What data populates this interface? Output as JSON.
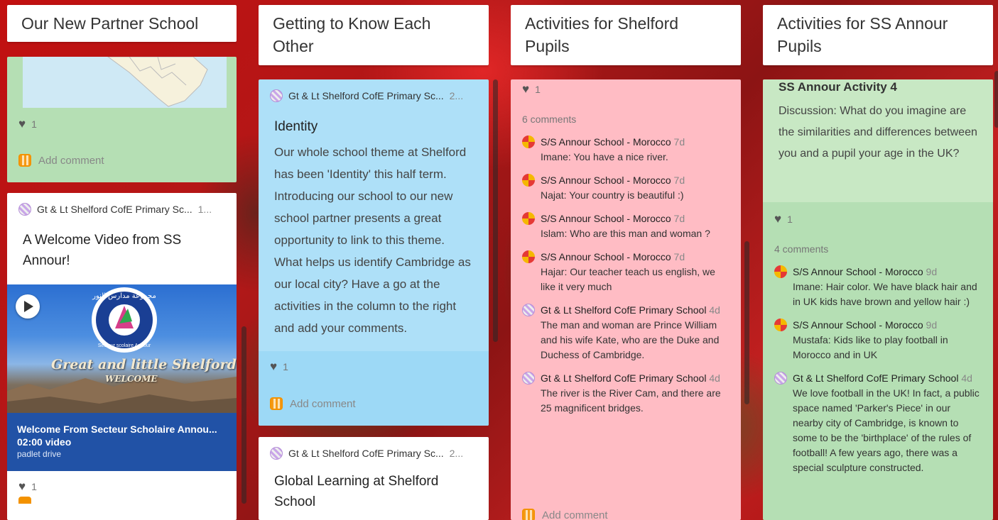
{
  "columns": [
    {
      "title": "Our New Partner School",
      "cards": [
        {
          "likes": "1",
          "add_comment": "Add comment"
        },
        {
          "author": "Gt & Lt Shelford CofE Primary Sc...",
          "time": "1...",
          "title": "A Welcome Video from SS Annour!",
          "video": {
            "arabic_caption": "مجموعة مدارس النور",
            "ring_caption": "Secteur scolaire Annour",
            "overlay_text": "Great and little Shelford",
            "overlay_text_2": "WELCOME",
            "name": "Welcome From Secteur Scholaire Annou...",
            "duration": "02:00 video",
            "source": "padlet drive"
          },
          "likes": "1"
        }
      ]
    },
    {
      "title": "Getting to Know Each Other",
      "cards": [
        {
          "author": "Gt & Lt Shelford CofE Primary Sc...",
          "time": "2...",
          "title": "Identity",
          "body": "Our whole school theme at Shelford has been 'Identity' this half term. Introducing our school to our new school partner presents a great opportunity to link to this theme. What helps us identify Cambridge as our local city? Have a go at the activities in the column to the right and add your comments.",
          "likes": "1",
          "add_comment": "Add comment"
        },
        {
          "author": "Gt & Lt Shelford CofE Primary Sc...",
          "time": "2...",
          "title": "Global Learning at Shelford School"
        }
      ]
    },
    {
      "title": "Activities for Shelford Pupils",
      "cards": [
        {
          "likes": "1",
          "comment_count": "6 comments",
          "comments": [
            {
              "author": "S/S Annour School - Morocco",
              "time": "7d",
              "text": "Imane: You have a nice river."
            },
            {
              "author": "S/S Annour School - Morocco",
              "time": "7d",
              "text": "Najat: Your country is beautiful :)"
            },
            {
              "author": "S/S Annour School - Morocco",
              "time": "7d",
              "text": "Islam: Who are this man and woman ?"
            },
            {
              "author": "S/S Annour School - Morocco",
              "time": "7d",
              "text": "Hajar: Our teacher teach us english, we like it very much"
            },
            {
              "author": "Gt & Lt Shelford CofE Primary School",
              "time": "4d",
              "text": "The man and woman are Prince William and his wife Kate, who are the Duke and Duchess of Cambridge."
            },
            {
              "author": "Gt & Lt Shelford CofE Primary School",
              "time": "4d",
              "text": "The river is the River Cam, and there are 25 magnificent bridges."
            }
          ],
          "add_comment": "Add comment"
        }
      ]
    },
    {
      "title": "Activities for SS Annour Pupils",
      "cards": [
        {
          "title": "SS Annour Activity 4",
          "body": "Discussion: What do you imagine are the similarities and differences between you and a pupil your age in the UK?",
          "likes": "1",
          "comment_count": "4 comments",
          "comments": [
            {
              "author": "S/S Annour School - Morocco",
              "time": "9d",
              "text": "Imane: Hair color. We have black hair and in UK kids have brown and yellow hair :)"
            },
            {
              "author": "S/S Annour School - Morocco",
              "time": "9d",
              "text": "Mustafa: Kids like to play football in Morocco and in UK"
            },
            {
              "author": "Gt & Lt Shelford CofE Primary School",
              "time": "4d",
              "text": "We love football in the UK! In fact, a public space named 'Parker's Piece' in our nearby city of Cambridge, is known to some to be the 'birthplace' of the rules of football! A few years ago, there was a special sculpture constructed."
            }
          ]
        }
      ]
    }
  ],
  "colors": {
    "green_card": "#b5dfb4",
    "green_card_light": "#c8e8c4",
    "blue_card": "#aee0f8",
    "blue_card_footer": "#9dd9f6",
    "pink_card": "#ffbcc4",
    "video_bar": "#2152a6"
  }
}
